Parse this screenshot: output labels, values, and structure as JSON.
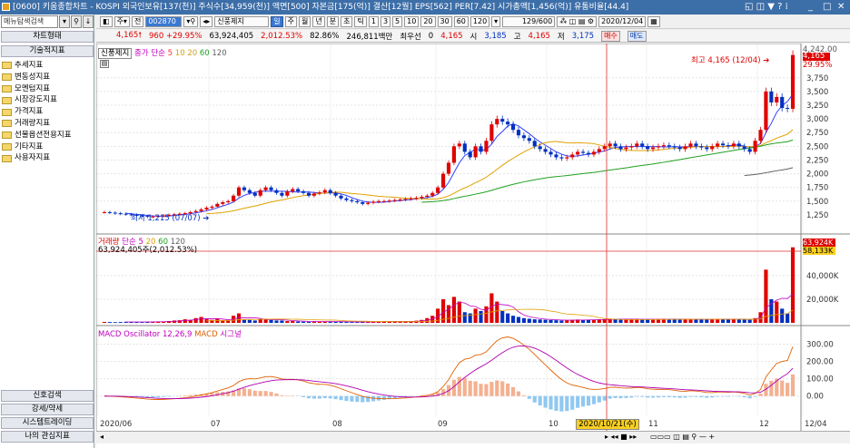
{
  "window": {
    "title": "[0600] 키움종합차트 - KOSPI 외국인보유[137(천)] 주식수[34,959(천)] 액면[500] 자본금[175(억)] 결산[12월] EPS[562] PER[7.42] 시가총액[1,456(억)] 유통비율[44.4]"
  },
  "sidebar": {
    "search_placeholder": "메뉴탐색검색",
    "header": "차트형태",
    "section": "기술적지표",
    "items": [
      "추세지표",
      "변동성지표",
      "모멘텀지표",
      "시장강도지표",
      "가격지표",
      "거래량지표",
      "선물옵션전용지표",
      "기타지표",
      "사용자지표"
    ],
    "bottom": [
      "신호검색",
      "강세/약세",
      "시스템트레이딩",
      "나의 관심지표"
    ]
  },
  "toolbar": {
    "code": "002870",
    "stock_name": "신풍제지",
    "tabs": [
      "일",
      "주",
      "월",
      "년",
      "분",
      "초",
      "틱"
    ],
    "active_tab": "일",
    "intervals": [
      "1",
      "3",
      "5",
      "10",
      "20",
      "30",
      "60",
      "120"
    ],
    "count": "129/600",
    "date": "2020/12/04"
  },
  "price": {
    "last": "4,165",
    "change": "960",
    "change_pct": "+29.95%",
    "volume": "63,924,405",
    "volume_pct": "2,012.53%",
    "turnover": "82.86%",
    "amount": "246,811백만",
    "pre_label": "최우선",
    "pre_val": "0",
    "pre_price": "4,165",
    "open_label": "시",
    "open": "3,185",
    "high_label": "고",
    "high": "4,165",
    "low_label": "저",
    "low": "3,175",
    "buy": "매수",
    "sell": "매도"
  },
  "panel_price": {
    "legend_name": "신풍제지",
    "legend_ma": "종가 단순",
    "ma_periods": [
      "5",
      "10",
      "20",
      "60",
      "120"
    ],
    "max_note": "최고 4,165 (12/04)",
    "min_note": "최저 1,215 (07/07)",
    "last_label": "4,165",
    "last_pct": "29.95%",
    "top_label": "4,242.00",
    "axis": [
      "3,750",
      "3,500",
      "3,250",
      "3,000",
      "2,750",
      "2,500",
      "2,250",
      "2,000",
      "1,750",
      "1,500",
      "1,250"
    ]
  },
  "panel_volume": {
    "legend_name": "거래량",
    "legend_ma": "단순",
    "ma_periods": [
      "5",
      "20",
      "60",
      "120"
    ],
    "value_note": "63,924,405주(2,012.53%)",
    "last_label": "63,924K",
    "ma_label": "58,133K",
    "axis": [
      "40,000K",
      "20,000K"
    ]
  },
  "panel_macd": {
    "legend_name": "MACD Oscillator 12,26,9",
    "legend_macd": "MACD",
    "legend_signal": "시그널",
    "axis": [
      "300.00",
      "200.00",
      "100.00",
      "0.00"
    ]
  },
  "xaxis": {
    "labels": [
      "2020/06",
      "07",
      "08",
      "09",
      "10",
      "11",
      "12",
      "12/04"
    ],
    "cursor": "2020/10/21(수)"
  },
  "chart_data": {
    "type": "candlestick",
    "dates_start": "2020/06",
    "dates_end": "2020/12/04",
    "close": [
      1300,
      1290,
      1280,
      1270,
      1260,
      1250,
      1240,
      1230,
      1215,
      1220,
      1230,
      1240,
      1250,
      1260,
      1270,
      1280,
      1300,
      1320,
      1350,
      1380,
      1400,
      1450,
      1480,
      1500,
      1600,
      1750,
      1700,
      1650,
      1600,
      1700,
      1750,
      1700,
      1650,
      1600,
      1680,
      1720,
      1680,
      1650,
      1600,
      1640,
      1660,
      1700,
      1650,
      1600,
      1550,
      1520,
      1500,
      1480,
      1450,
      1470,
      1490,
      1500,
      1500,
      1510,
      1520,
      1530,
      1540,
      1550,
      1560,
      1580,
      1600,
      1650,
      1750,
      2000,
      2200,
      2500,
      2550,
      2400,
      2300,
      2500,
      2400,
      2600,
      2900,
      3000,
      2950,
      2900,
      2800,
      2700,
      2650,
      2600,
      2500,
      2450,
      2400,
      2350,
      2300,
      2280,
      2300,
      2350,
      2400,
      2380,
      2350,
      2400,
      2450,
      2500,
      2550,
      2500,
      2450,
      2480,
      2500,
      2550,
      2500,
      2450,
      2480,
      2500,
      2520,
      2500,
      2480,
      2450,
      2500,
      2550,
      2500,
      2480,
      2450,
      2500,
      2550,
      2520,
      2500,
      2550,
      2500,
      2450,
      2400,
      2600,
      2800,
      3500,
      3300,
      3400,
      3200,
      3185,
      4165
    ],
    "volume_k": [
      800,
      700,
      600,
      700,
      900,
      800,
      700,
      600,
      900,
      1000,
      1200,
      1100,
      1500,
      2000,
      2200,
      3000,
      2500,
      4000,
      5000,
      3000,
      2500,
      3500,
      2000,
      1800,
      6000,
      8000,
      3000,
      2500,
      2000,
      3000,
      3500,
      2500,
      2000,
      2000,
      1500,
      1500,
      1200,
      1000,
      900,
      1000,
      1100,
      1200,
      1000,
      900,
      800,
      800,
      700,
      700,
      900,
      800,
      1000,
      1200,
      1500,
      1200,
      1000,
      1100,
      1300,
      1500,
      1800,
      2500,
      4000,
      6000,
      12000,
      20000,
      15000,
      22000,
      18000,
      9000,
      8000,
      12000,
      10000,
      14000,
      25000,
      18000,
      10000,
      8000,
      6000,
      5000,
      4000,
      3500,
      3000,
      2800,
      2600,
      2400,
      2200,
      2000,
      2200,
      2500,
      2800,
      2600,
      2400,
      2600,
      3000,
      3200,
      3500,
      3000,
      2800,
      3000,
      3200,
      3400,
      3000,
      2800,
      3000,
      3200,
      3300,
      3100,
      2900,
      2800,
      3000,
      3300,
      3000,
      2900,
      2800,
      3000,
      3300,
      3100,
      3000,
      3300,
      3000,
      2800,
      2600,
      4000,
      9000,
      45000,
      20000,
      18000,
      12000,
      8000,
      63924
    ],
    "ylim": [
      1100,
      4242
    ]
  }
}
